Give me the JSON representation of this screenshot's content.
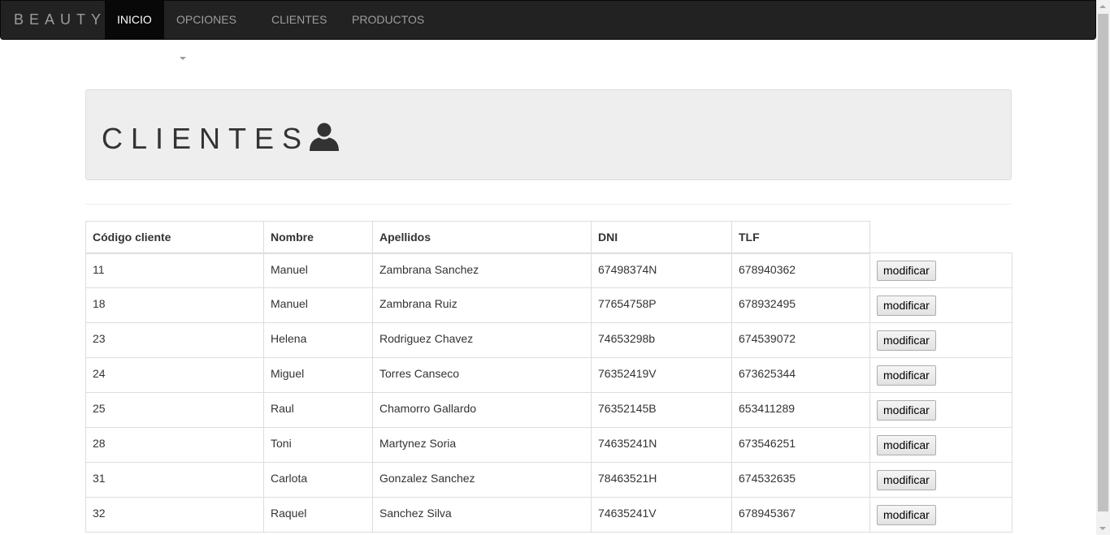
{
  "navbar": {
    "brand": "BEAUTY",
    "items": [
      {
        "label": "INICIO",
        "active": true
      },
      {
        "label": "OPCIONES",
        "dropdown": true
      },
      {
        "label": "CLIENTES"
      },
      {
        "label": "PRODUCTOS"
      }
    ]
  },
  "header": {
    "title": "CLIENTES",
    "icon": "user-icon"
  },
  "table": {
    "columns": [
      "Código cliente",
      "Nombre",
      "Apellidos",
      "DNI",
      "TLF"
    ],
    "action_label": "modificar",
    "rows": [
      {
        "codigo": "11",
        "nombre": "Manuel",
        "apellidos": "Zambrana Sanchez",
        "dni": "67498374N",
        "tlf": "678940362"
      },
      {
        "codigo": "18",
        "nombre": "Manuel",
        "apellidos": "Zambrana Ruiz",
        "dni": "77654758P",
        "tlf": "678932495"
      },
      {
        "codigo": "23",
        "nombre": "Helena",
        "apellidos": "Rodriguez Chavez",
        "dni": "74653298b",
        "tlf": "674539072"
      },
      {
        "codigo": "24",
        "nombre": "Miguel",
        "apellidos": "Torres Canseco",
        "dni": "76352419V",
        "tlf": "673625344"
      },
      {
        "codigo": "25",
        "nombre": "Raul",
        "apellidos": "Chamorro Gallardo",
        "dni": "76352145B",
        "tlf": "653411289"
      },
      {
        "codigo": "28",
        "nombre": "Toni",
        "apellidos": "Martynez Soria",
        "dni": "74635241N",
        "tlf": "673546251"
      },
      {
        "codigo": "31",
        "nombre": "Carlota",
        "apellidos": "Gonzalez Sanchez",
        "dni": "78463521H",
        "tlf": "674532635"
      },
      {
        "codigo": "32",
        "nombre": "Raquel",
        "apellidos": "Sanchez Silva",
        "dni": "74635241V",
        "tlf": "678945367"
      }
    ]
  },
  "colors": {
    "navbar_bg": "#222222",
    "navbar_active_bg": "#080808",
    "navbar_text": "#9d9d9d",
    "jumbotron_bg": "#eeeeee",
    "border": "#dddddd"
  }
}
